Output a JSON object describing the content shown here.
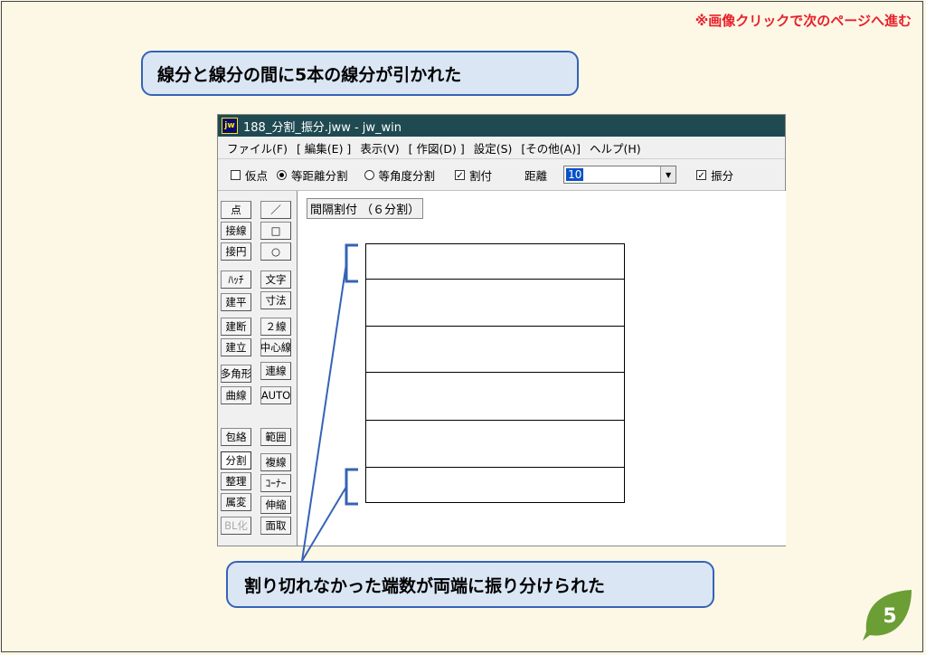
{
  "slide": {
    "top_note": "※画像クリックで次のページへ進む",
    "callout_top": "線分と線分の間に5本の線分が引かれた",
    "callout_bottom": "割り切れなかった端数が両端に振り分けられた",
    "page_number": "5",
    "colors": {
      "callout_fill": "#dbe6f5",
      "callout_border": "#3563b6",
      "note": "#e8202a",
      "badge": "#6b9e35"
    }
  },
  "window": {
    "icon_text": "jw",
    "title": "188_分割_振分.jww - jw_win",
    "menu": [
      "ファイル(F)",
      "[ 編集(E) ]",
      "表示(V)",
      "[ 作図(D) ]",
      "設定(S)",
      "[その他(A)]",
      "ヘルプ(H)"
    ],
    "toolbar": {
      "karitten": "仮点",
      "equal_distance": "等距離分割",
      "equal_angle": "等角度分割",
      "waritsuke": "割付",
      "distance_label": "距離",
      "distance_value": "10",
      "furiwake": "振分"
    },
    "tools_left": [
      "点",
      "接線",
      "接円",
      "ﾊｯﾁ",
      "建平",
      "建断",
      "建立",
      "多角形",
      "曲線",
      "包絡",
      "分割",
      "整理",
      "属変",
      "BL化"
    ],
    "tools_right": [
      "／",
      "□",
      "○",
      "文字",
      "寸法",
      "２線",
      "中心線",
      "連線",
      "AUTO",
      "範囲",
      "複線",
      "ｺｰﾅｰ",
      "伸縮",
      "面取"
    ],
    "status": "間隔割付 （６分割）"
  }
}
